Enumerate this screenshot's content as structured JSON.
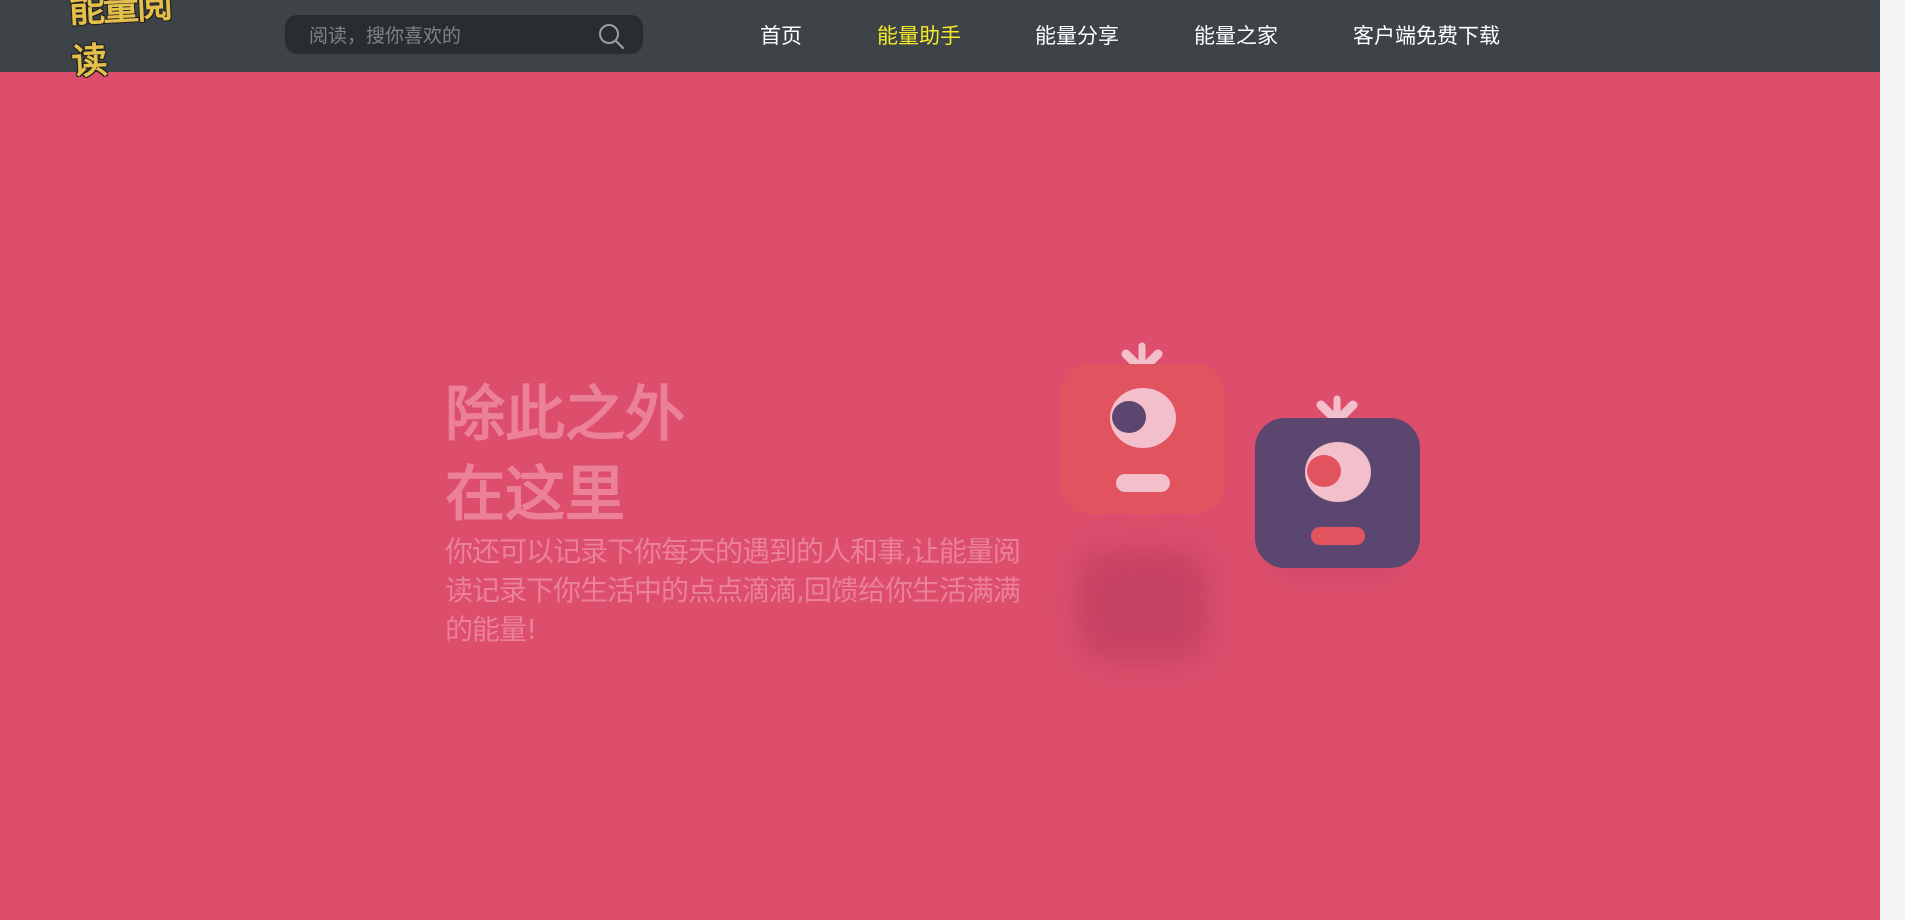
{
  "header": {
    "logo_text": "能量阅读",
    "search_placeholder": "阅读，搜你喜欢的",
    "nav": [
      {
        "label": "首页",
        "active": false
      },
      {
        "label": "能量助手",
        "active": true
      },
      {
        "label": "能量分享",
        "active": false
      },
      {
        "label": "能量之家",
        "active": false
      },
      {
        "label": "客户端免费下载",
        "active": false
      }
    ]
  },
  "hero": {
    "title_line1": "除此之外",
    "title_line2": "在这里",
    "description": "你还可以记录下你每天的遇到的人和事,让能量阅读记录下你生活中的点点滴滴,回馈给你生活满满的能量!"
  },
  "colors": {
    "background": "#dc4e6c",
    "header": "#3d4347",
    "nav_active": "#f4ea2b",
    "hero_text": "#ec8096",
    "robot_red": "#e0535f",
    "robot_purple": "#5b4670",
    "robot_pink": "#f3bfcb"
  },
  "icons": {
    "search": "search-icon",
    "robot_left": "red-robot-icon",
    "robot_right": "purple-robot-icon"
  }
}
